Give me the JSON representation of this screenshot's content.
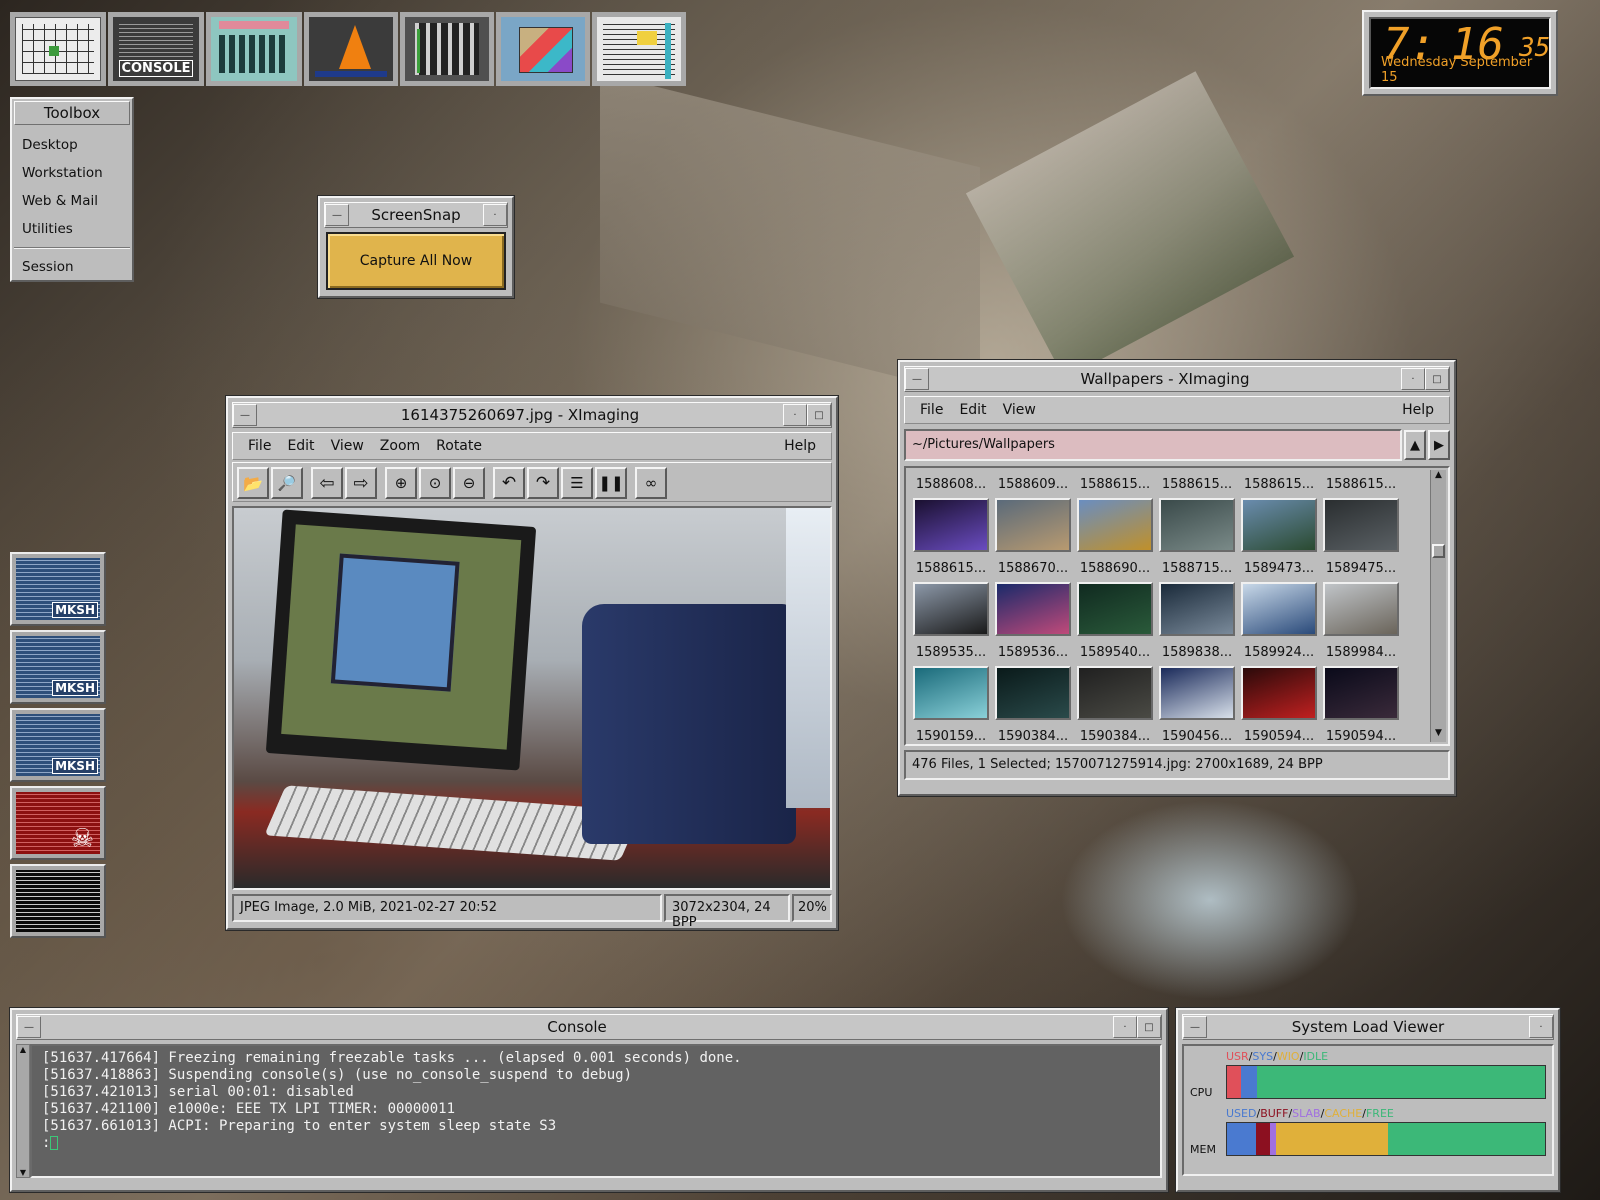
{
  "launcher": {
    "console_label": "CONSOLE"
  },
  "clock": {
    "hours": "7:",
    "minutes": "16",
    "seconds": "35",
    "date": "Wednesday September 15"
  },
  "toolbox": {
    "title": "Toolbox",
    "items": [
      "Desktop",
      "Workstation",
      "Web & Mail",
      "Utilities"
    ],
    "session": "Session"
  },
  "screensnap": {
    "title": "ScreenSnap",
    "button": "Capture All Now",
    "button_color": "#e0b44c"
  },
  "viewer": {
    "title": "1614375260697.jpg - XImaging",
    "menu": [
      "File",
      "Edit",
      "View",
      "Zoom",
      "Rotate"
    ],
    "help": "Help",
    "toolbar_icons": [
      "open-icon",
      "browse-icon",
      "previous-icon",
      "next-icon",
      "zoom-in-icon",
      "zoom-fit-icon",
      "zoom-out-icon",
      "rotate-left-icon",
      "rotate-right-icon",
      "flip-vertical-icon",
      "flip-horizontal-icon",
      "slideshow-icon"
    ],
    "status": {
      "info": "JPEG Image, 2.0 MiB, 2021-02-27 20:52",
      "dims": "3072x2304, 24 BPP",
      "zoom": "20%"
    }
  },
  "browser": {
    "title": "Wallpapers - XImaging",
    "menu": [
      "File",
      "Edit",
      "View"
    ],
    "help": "Help",
    "path": "~/Pictures/Wallpapers",
    "path_bg": "#dcbcc0",
    "rows": [
      {
        "labels": [
          "1588608...",
          "1588609...",
          "1588615...",
          "1588615...",
          "1588615...",
          "1588615..."
        ],
        "thumbs": []
      },
      {
        "labels": [
          "1588615...",
          "1588670...",
          "1588690...",
          "1588715...",
          "1589473...",
          "1589475..."
        ],
        "thumbs": [
          [
            "#1a1030",
            "#6a4cc0"
          ],
          [
            "#5a6a7a",
            "#b89a70"
          ],
          [
            "#6a8ec0",
            "#c0902a"
          ],
          [
            "#3a4a4a",
            "#7a8a88"
          ],
          [
            "#6a8cae",
            "#2a4a30"
          ],
          [
            "#2a2e30",
            "#5a6064"
          ]
        ]
      },
      {
        "labels": [
          "1589535...",
          "1589536...",
          "1589540...",
          "1589838...",
          "1589924...",
          "1589984..."
        ],
        "thumbs": [
          [
            "#8c98a8",
            "#1a1a1a"
          ],
          [
            "#1a2a6a",
            "#c04a7a"
          ],
          [
            "#102a20",
            "#2a5a3a"
          ],
          [
            "#1a2a3a",
            "#7a8a9a"
          ],
          [
            "#c8d8e8",
            "#2a4a7a"
          ],
          [
            "#c0c4c8",
            "#6a645a"
          ]
        ]
      },
      {
        "labels": [
          "1590159...",
          "1590384...",
          "1590384...",
          "1590456...",
          "1590594...",
          "1590594..."
        ],
        "thumbs": [
          [
            "#1a6a7a",
            "#8ad0d8"
          ],
          [
            "#0a1a1a",
            "#2a4a4a"
          ],
          [
            "#202020",
            "#4a4a44"
          ],
          [
            "#1a2a5a",
            "#d8e0ea"
          ],
          [
            "#2a0a0a",
            "#c02020"
          ],
          [
            "#0a0a1a",
            "#3a2a3a"
          ]
        ]
      }
    ],
    "status": "476 Files, 1 Selected; 1570071275914.jpg: 2700x1689, 24 BPP"
  },
  "console": {
    "title": "Console",
    "lines": [
      "[51637.417664] Freezing remaining freezable tasks ... (elapsed 0.001 seconds) done.",
      "[51637.418863] Suspending console(s) (use no_console_suspend to debug)",
      "[51637.421013] serial 00:01: disabled",
      "[51637.421100] e1000e: EEE TX LPI TIMER: 00000011",
      "[51637.661013] ACPI: Preparing to enter system sleep state S3"
    ],
    "prompt": ":"
  },
  "sysload": {
    "title": "System Load Viewer",
    "cpu_label": "CPU",
    "mem_label": "MEM",
    "cpu_legend": [
      "USR",
      "SYS",
      "WIO",
      "IDLE"
    ],
    "mem_legend": [
      "USED",
      "BUFF",
      "SLAB",
      "CACHE",
      "FREE"
    ],
    "cpu_colors": [
      "#e0505a",
      "#4a7ad0",
      "#e0b03a",
      "#3cb878"
    ],
    "mem_colors": [
      "#4a7ad0",
      "#8c1020",
      "#a070e0",
      "#e0b03a",
      "#3cb878"
    ],
    "cpu_values": [
      0.045,
      0.05,
      0,
      0.905
    ],
    "mem_values": [
      0.09,
      0.045,
      0.02,
      0.35,
      0.495
    ]
  },
  "tiles": [
    {
      "label": "MKSH"
    },
    {
      "label": "MKSH"
    },
    {
      "label": "MKSH"
    },
    {
      "label": ""
    },
    {
      "label": ""
    }
  ]
}
